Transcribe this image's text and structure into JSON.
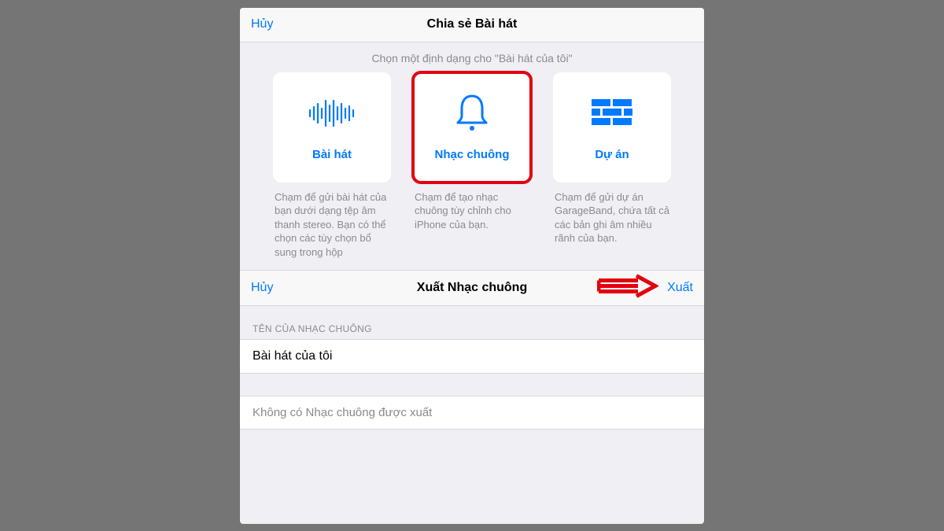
{
  "share_header": {
    "cancel": "Hủy",
    "title": "Chia sẻ Bài hát"
  },
  "subtitle": "Chọn một định dạng cho \"Bài hát của tôi\"",
  "formats": [
    {
      "key": "song",
      "label": "Bài hát",
      "desc": "Chạm để gửi bài hát của bạn dưới dạng tệp âm thanh stereo. Bạn có thể chọn các tùy chọn bổ sung trong hộp",
      "selected": false
    },
    {
      "key": "ringtone",
      "label": "Nhạc chuông",
      "desc": "Chạm để tạo nhạc chuông tùy chỉnh cho iPhone của bạn.",
      "selected": true
    },
    {
      "key": "project",
      "label": "Dự án",
      "desc": "Chạm để gửi dự án GarageBand, chứa tất cả các bản ghi âm nhiều rãnh của bạn.",
      "selected": false
    }
  ],
  "export_header": {
    "cancel": "Hủy",
    "title": "Xuất Nhạc chuông",
    "action": "Xuất"
  },
  "ringtone_name": {
    "section": "TÊN CỦA NHẠC CHUÔNG",
    "value": "Bài hát của tôi"
  },
  "empty_state": "Không có Nhạc chuông được xuất",
  "annotation": {
    "highlight_card": "ringtone",
    "arrow_target": "export-button"
  }
}
